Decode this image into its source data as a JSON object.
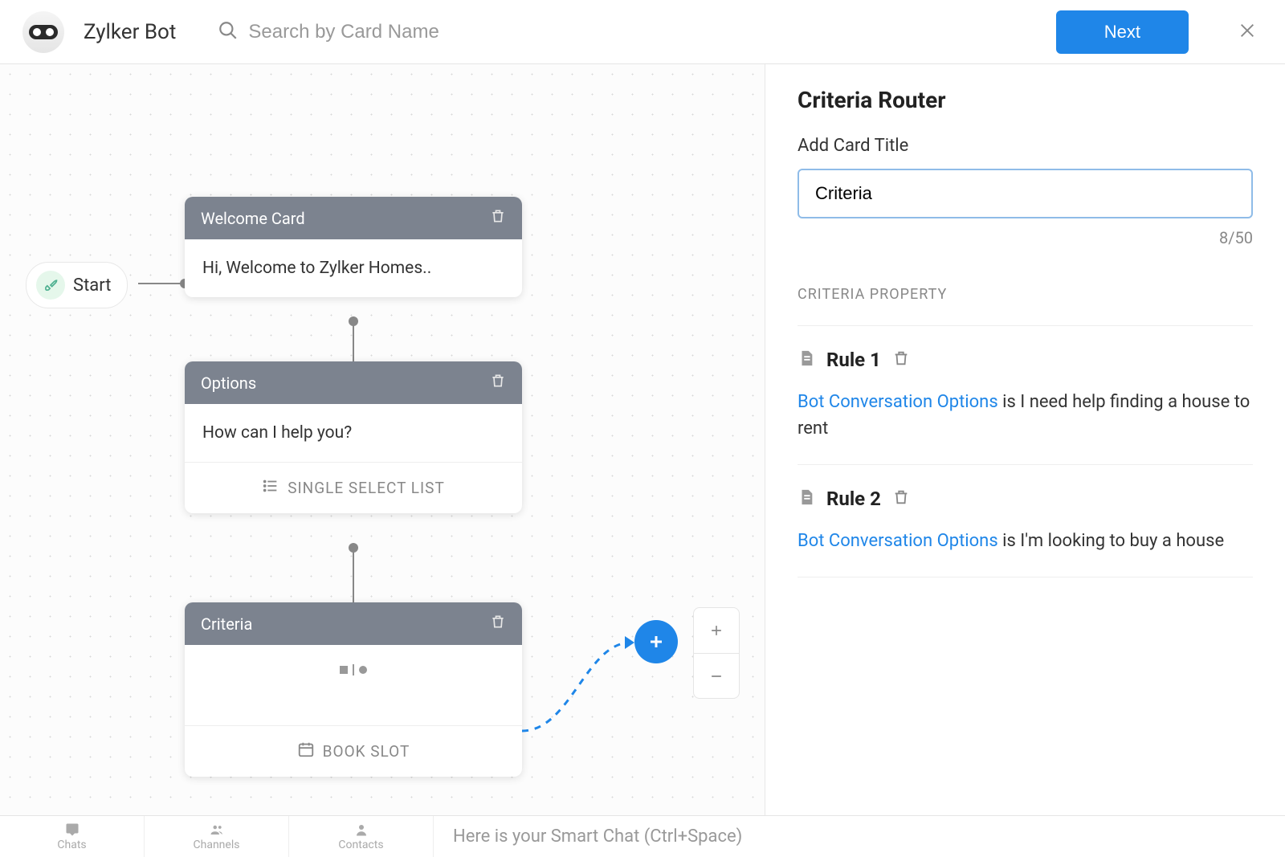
{
  "header": {
    "bot_name": "Zylker Bot",
    "search_placeholder": "Search by Card Name",
    "next_label": "Next"
  },
  "canvas": {
    "start_label": "Start",
    "cards": {
      "welcome": {
        "title": "Welcome Card",
        "body": "Hi, Welcome to Zylker Homes.."
      },
      "options": {
        "title": "Options",
        "body": "How can I help you?",
        "action": "SINGLE SELECT LIST"
      },
      "criteria": {
        "title": "Criteria",
        "action": "BOOK SLOT"
      }
    }
  },
  "panel": {
    "title": "Criteria Router",
    "field_label": "Add Card Title",
    "title_value": "Criteria",
    "char_count": "8/50",
    "section_label": "CRITERIA PROPERTY",
    "rules": [
      {
        "name": "Rule 1",
        "link": "Bot Conversation Options",
        "text": " is I need help finding a house to rent"
      },
      {
        "name": "Rule 2",
        "link": "Bot Conversation Options",
        "text": " is I'm looking to buy a house"
      }
    ]
  },
  "bottom": {
    "tabs": [
      "Chats",
      "Channels",
      "Contacts"
    ],
    "smart_chat": "Here is your Smart Chat (Ctrl+Space)"
  }
}
